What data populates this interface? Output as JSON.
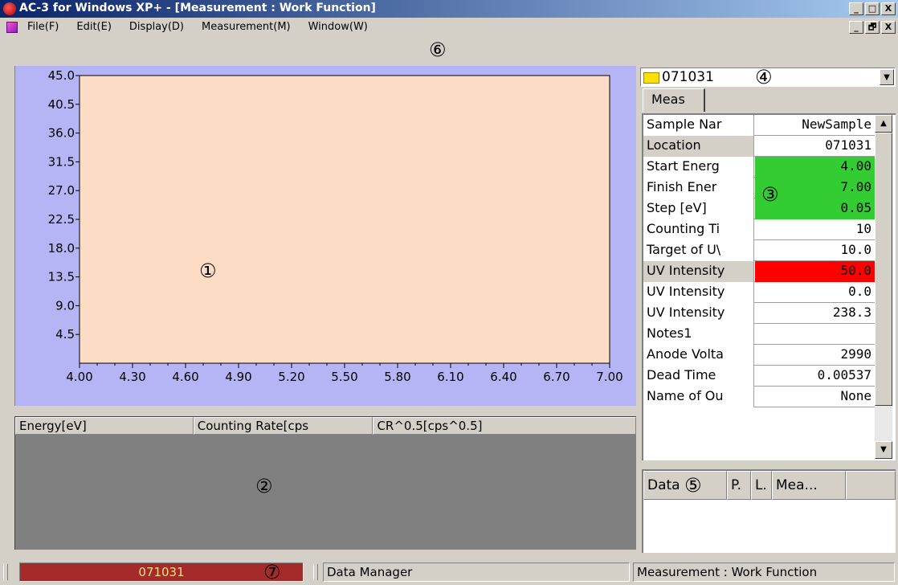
{
  "window": {
    "title": "AC-3 for Windows XP+ - [Measurement : Work Function]",
    "minimize": "_",
    "maximize": "□",
    "restore": "🗗",
    "close": "X"
  },
  "menu": {
    "items": [
      "File(F)",
      "Edit(E)",
      "Display(D)",
      "Measurement(M)",
      "Window(W)"
    ]
  },
  "chart_data": {
    "type": "line",
    "xlim": [
      4.0,
      7.0
    ],
    "ylim": [
      0,
      45.0
    ],
    "xticks": [
      "4.00",
      "4.30",
      "4.60",
      "4.90",
      "5.20",
      "5.50",
      "5.80",
      "6.10",
      "6.40",
      "6.70",
      "7.00"
    ],
    "yticks": [
      "45.0",
      "40.5",
      "36.0",
      "31.5",
      "27.0",
      "22.5",
      "18.0",
      "13.5",
      "9.0",
      "4.5"
    ],
    "series": [],
    "plot_background": "#fddcc6",
    "frame_background": "#b5b5f5"
  },
  "table": {
    "columns": [
      "Energy[eV]",
      "Counting Rate[cps",
      "CR^0.5[cps^0.5]"
    ],
    "rows": []
  },
  "folder": {
    "name": "071031"
  },
  "tabs": {
    "meas": "Meas"
  },
  "properties": [
    {
      "name": "Sample Nar",
      "value": "NewSample",
      "highlight": "none"
    },
    {
      "name": "Location",
      "value": "071031",
      "highlight": "none"
    },
    {
      "name": "Start Energ",
      "value": "4.00",
      "highlight": "green"
    },
    {
      "name": "Finish Ener",
      "value": "7.00",
      "highlight": "green"
    },
    {
      "name": "Step [eV]",
      "value": "0.05",
      "highlight": "green"
    },
    {
      "name": "Counting Ti",
      "value": "10",
      "highlight": "none"
    },
    {
      "name": "Target of U\\",
      "value": "10.0",
      "highlight": "none"
    },
    {
      "name": "UV Intensity",
      "value": "50.0",
      "highlight": "red"
    },
    {
      "name": "UV Intensity",
      "value": "0.0",
      "highlight": "none"
    },
    {
      "name": "UV Intensity",
      "value": "238.3",
      "highlight": "none"
    },
    {
      "name": "Notes1",
      "value": "",
      "highlight": "none"
    },
    {
      "name": "Anode Volta",
      "value": "2990",
      "highlight": "none"
    },
    {
      "name": "Dead Time",
      "value": "0.00537",
      "highlight": "none"
    },
    {
      "name": "Name of Ou",
      "value": "None",
      "highlight": "none"
    }
  ],
  "data_list": {
    "columns": [
      "Data",
      "P.",
      "L.",
      "Mea..."
    ]
  },
  "status": {
    "location": "071031",
    "manager": "Data Manager",
    "mode": "Measurement : Work Function"
  },
  "annotations": {
    "a1": "①",
    "a2": "②",
    "a3": "③",
    "a4": "④",
    "a5": "⑤",
    "a6": "⑥",
    "a7": "⑦"
  },
  "colors": {
    "highlight_green": "#33cc33",
    "highlight_red": "#ff0000",
    "status_location_bg": "#a52a2a"
  }
}
